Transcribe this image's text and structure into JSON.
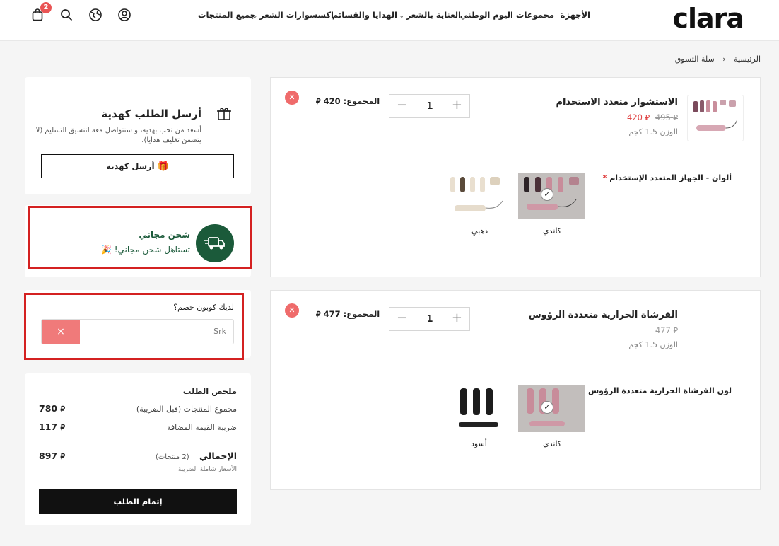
{
  "header": {
    "logo": "clara",
    "nav": [
      {
        "label": "الأجهزة",
        "dropdown": false
      },
      {
        "label": "مجموعات اليوم الوطني",
        "dropdown": true
      },
      {
        "label": "العناية بالشعر",
        "dropdown": true
      },
      {
        "label": "الهدايا والقسائم",
        "dropdown": false
      },
      {
        "label": "اكسسوارات الشعر",
        "dropdown": true
      },
      {
        "label": "جميع المنتجات",
        "dropdown": false
      }
    ],
    "cart_count": "2",
    "icons": [
      "user-icon",
      "globe-icon",
      "search-icon",
      "cart-icon"
    ]
  },
  "breadcrumb": {
    "home": "الرئيسية",
    "sep": "‹",
    "current": "سلة التسوق"
  },
  "currency": "⃁",
  "products": [
    {
      "name": "الاستشوار متعدد الاستخدام",
      "old_price": "495",
      "price": "420",
      "weight": "الوزن 1.5 كجم",
      "total_label": "المجموع:",
      "total": "420",
      "qty": "1",
      "option_label": "ألوان - الجهاز المتعدد الإستخدام",
      "required": "*",
      "swatches": [
        {
          "label": "كاندي",
          "selected": true
        },
        {
          "label": "ذهبي",
          "selected": false
        }
      ]
    },
    {
      "name": "الفرشاة الحرارية متعددة الرؤوس",
      "old_price": "",
      "price": "477",
      "weight": "الوزن 1.5 كجم",
      "total_label": "المجموع:",
      "total": "477",
      "qty": "1",
      "option_label": "لون الفرشاة الحرارية متعددة الرؤوس",
      "required": "*",
      "swatches": [
        {
          "label": "كاندي",
          "selected": true
        },
        {
          "label": "أسود",
          "selected": false
        }
      ]
    }
  ],
  "gift": {
    "title": "أرسل الطلب كهدية",
    "desc_1": "أسعد من تحب بهدية، و سنتواصل معه لتنسيق التسليم (لا",
    "desc_2": "يتضمن تغليف هدايا).",
    "button": "أرسل كهدية"
  },
  "shipping": {
    "title": "شحن مجاني",
    "subtitle": "تستاهل شحن مجاني! 🎉"
  },
  "coupon": {
    "label": "لديك كوبون خصم؟",
    "value": "Srk",
    "clear": "×"
  },
  "summary": {
    "title": "ملخص الطلب",
    "subtotal_label": "مجموع المنتجات (قبل الضريبة)",
    "subtotal": "780",
    "vat_label": "ضريبة القيمة المضافة",
    "vat": "117",
    "total_label": "الإجمالي",
    "items_count": "(2 منتجات)",
    "total": "897",
    "tax_note": "الأسعار شاملة الضريبة",
    "checkout": "إتمام الطلب"
  },
  "colors": {
    "accent": "#111111",
    "danger": "#e95454",
    "shipping_green": "#1b5a3a",
    "sale_red": "#e04545",
    "highlight_box": "#d42121"
  }
}
